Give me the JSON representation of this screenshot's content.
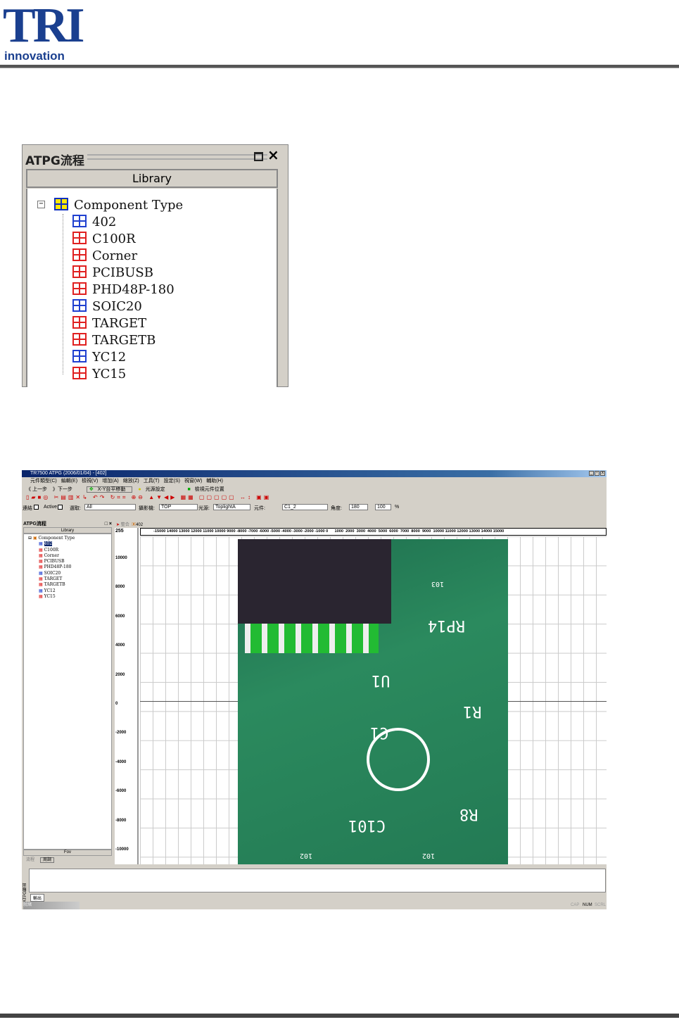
{
  "logo": {
    "text": "TRI",
    "subtitle": "innovation"
  },
  "panel": {
    "title": "ATPG流程",
    "tab": "Library",
    "root": "Component Type",
    "items": [
      {
        "label": "402",
        "color": "#2040d0"
      },
      {
        "label": "C100R",
        "color": "#e02020"
      },
      {
        "label": "Corner",
        "color": "#e02020"
      },
      {
        "label": "PCIBUSB",
        "color": "#e02020"
      },
      {
        "label": "PHD48P-180",
        "color": "#e02020"
      },
      {
        "label": "SOIC20",
        "color": "#2040d0"
      },
      {
        "label": "TARGET",
        "color": "#e02020"
      },
      {
        "label": "TARGETB",
        "color": "#e02020"
      },
      {
        "label": "YC12",
        "color": "#2040d0"
      },
      {
        "label": "YC15",
        "color": "#e02020"
      }
    ]
  },
  "app": {
    "title": "TR7500 ATPG (2006/01/04) - [402]",
    "menu": [
      "元件類型(C)",
      "編輯(E)",
      "檢視(V)",
      "增加(A)",
      "縮放(Z)",
      "工具(T)",
      "設定(S)",
      "視窗(W)",
      "輔助(H)"
    ],
    "nav": {
      "prev": "《 上一步",
      "next": "》下一步",
      "xy": "X-Y台平移動",
      "light": "光源設定",
      "locate": "檢視元件位置"
    },
    "filters": {
      "link_label": "連結",
      "active_label": "Active",
      "select_label": "選取:",
      "select_value": "All",
      "camera_label": "攝影機:",
      "camera_value": "TOP",
      "light_label": "光源:",
      "light_value": "ToplightA",
      "part_label": "元件:",
      "part_value": "C1_2",
      "angle_label": "角度:",
      "angle_value": "180",
      "zoom_value": "100",
      "pct": "%"
    },
    "side": {
      "title": "ATPG流程",
      "tab": "Library",
      "root": "Component Type",
      "items": [
        "402",
        "C100R",
        "Corner",
        "PCIBUSB",
        "PHD48P-180",
        "SOIC20",
        "TARGET",
        "TARGETB",
        "YC12",
        "YC15"
      ],
      "footer": "Fov",
      "tabs": [
        "流程",
        "周調"
      ]
    },
    "doc_tabs": [
      "整合",
      "402"
    ],
    "ruler_corner": "255",
    "hruler": "-15000 14000 13000 12000 11000 10000 9000 -8000 -7000 -6000 -5000 -4000 -3000 -2000 -1000 0      1000  2000  3000  4000  5000  6000  7000  8000  9000  10000 11000 12000 13000 14000 15000",
    "vruler": [
      "10000",
      "8000",
      "6000",
      "4000",
      "2000",
      "0",
      "-2000",
      "-4000",
      "-6000",
      "-8000",
      "-10000"
    ],
    "pcb_labels": [
      "103",
      "RP14",
      "U1",
      "R1",
      "C1",
      "R8",
      "C101",
      "102",
      "102"
    ],
    "output": {
      "side": "ATPG輸出",
      "tab": "輸出"
    },
    "status": {
      "left": "就緒",
      "caps": "CAP",
      "num": "NUM",
      "scrl": "SCRL"
    }
  }
}
